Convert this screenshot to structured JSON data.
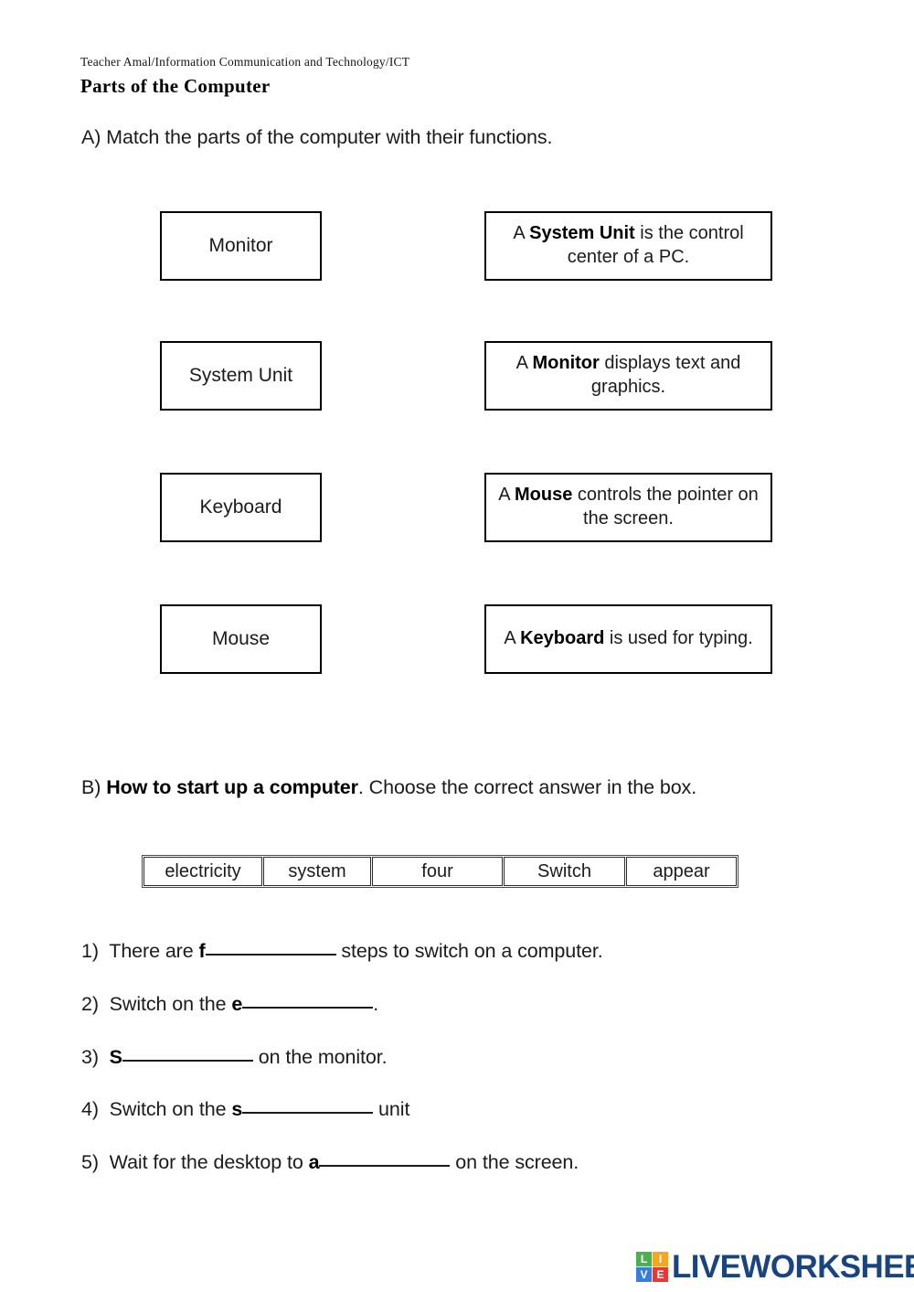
{
  "header": {
    "breadcrumb": "Teacher Amal/Information Communication and Technology/ICT",
    "title": "Parts of the Computer"
  },
  "section_a": {
    "label": "A)",
    "instruction": "Match the parts of the computer with their functions.",
    "full_instruction": "A) Match the parts of the computer with their functions.",
    "left_items": [
      {
        "label": "Monitor"
      },
      {
        "label": "System Unit"
      },
      {
        "label": "Keyboard"
      },
      {
        "label": "Mouse"
      }
    ],
    "right_items": [
      {
        "pre": "A ",
        "bold": "System Unit",
        "post": " is the control center of a PC."
      },
      {
        "pre": "A ",
        "bold": "Monitor",
        "post": " displays text and graphics."
      },
      {
        "pre": "A ",
        "bold": "Mouse",
        "post": " controls the pointer on the screen."
      },
      {
        "pre": "A ",
        "bold": "Keyboard",
        "post": " is used for typing."
      }
    ]
  },
  "section_b": {
    "label": "B)",
    "heading_bold": "How to start up a computer",
    "instruction_rest": ". Choose the correct answer in the box.",
    "word_bank": [
      "electricity",
      "system",
      "four",
      "Switch",
      "appear"
    ],
    "questions": [
      {
        "num": "1)",
        "pre": "There are ",
        "seed": "f",
        "post": " steps to switch on a computer."
      },
      {
        "num": "2)",
        "pre": "Switch on the ",
        "seed": "e",
        "post": "."
      },
      {
        "num": "3)",
        "pre": "",
        "seed": "S",
        "post": " on the monitor."
      },
      {
        "num": "4)",
        "pre": "Switch on the ",
        "seed": "s",
        "post": " unit"
      },
      {
        "num": "5)",
        "pre": "Wait for the desktop to ",
        "seed": "a",
        "post": " on the screen."
      }
    ]
  },
  "logo": {
    "wordmark": "LIVEWORKSHEETS",
    "tiles": [
      {
        "letter": "L",
        "color": "#4caf50"
      },
      {
        "letter": "I",
        "color": "#f5a623"
      },
      {
        "letter": "V",
        "color": "#3b7ddd"
      },
      {
        "letter": "E",
        "color": "#e53935"
      }
    ],
    "wordmark_color": "#1a4480"
  }
}
